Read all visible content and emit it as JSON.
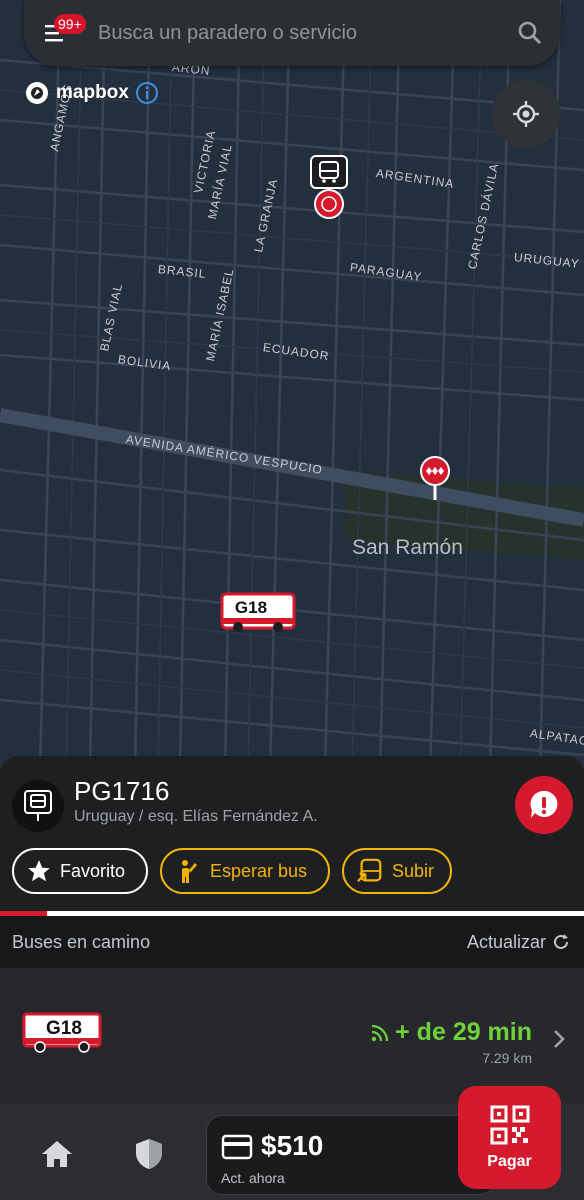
{
  "search": {
    "placeholder": "Busca un paradero o servicio",
    "badge": "99+",
    "menu_icon": "menu-icon",
    "search_icon": "search-icon"
  },
  "map": {
    "attribution": "mapbox",
    "area_label": "San Ramón",
    "streets": [
      "ARGENTINA",
      "VICTORIA",
      "MARÍA VIAL",
      "LA GRANJA",
      "CARLOS DÁVILA",
      "URUGUAY",
      "BRASIL",
      "PARAGUAY",
      "BLAS VIAL",
      "MARÍA ISABEL",
      "ECUADOR",
      "BOLIVIA",
      "AVENIDA AMÉRICO VESPUCIO",
      "ALPATAC",
      "ANGAMOS",
      "ARON"
    ],
    "bus_marker_label": "G18"
  },
  "stop": {
    "code": "PG1716",
    "address": "Uruguay / esq. Elías Fernández A.",
    "icon": "bus-stop-icon",
    "report_icon": "alert-icon"
  },
  "actions": {
    "favorite": "Favorito",
    "wait": "Esperar bus",
    "board": "Subir"
  },
  "refresh_progress": 0.08,
  "buses": {
    "title": "Buses en camino",
    "refresh_label": "Actualizar",
    "items": [
      {
        "route": "G18",
        "eta": "+ de 29 min",
        "distance": "7.29 km"
      }
    ]
  },
  "wallet": {
    "balance": "$510",
    "updated": "Act. ahora",
    "pay_label": "Pagar"
  },
  "colors": {
    "accent_red": "#d51a2e",
    "accent_yellow": "#f2b400",
    "eta_green": "#6fd13a"
  }
}
